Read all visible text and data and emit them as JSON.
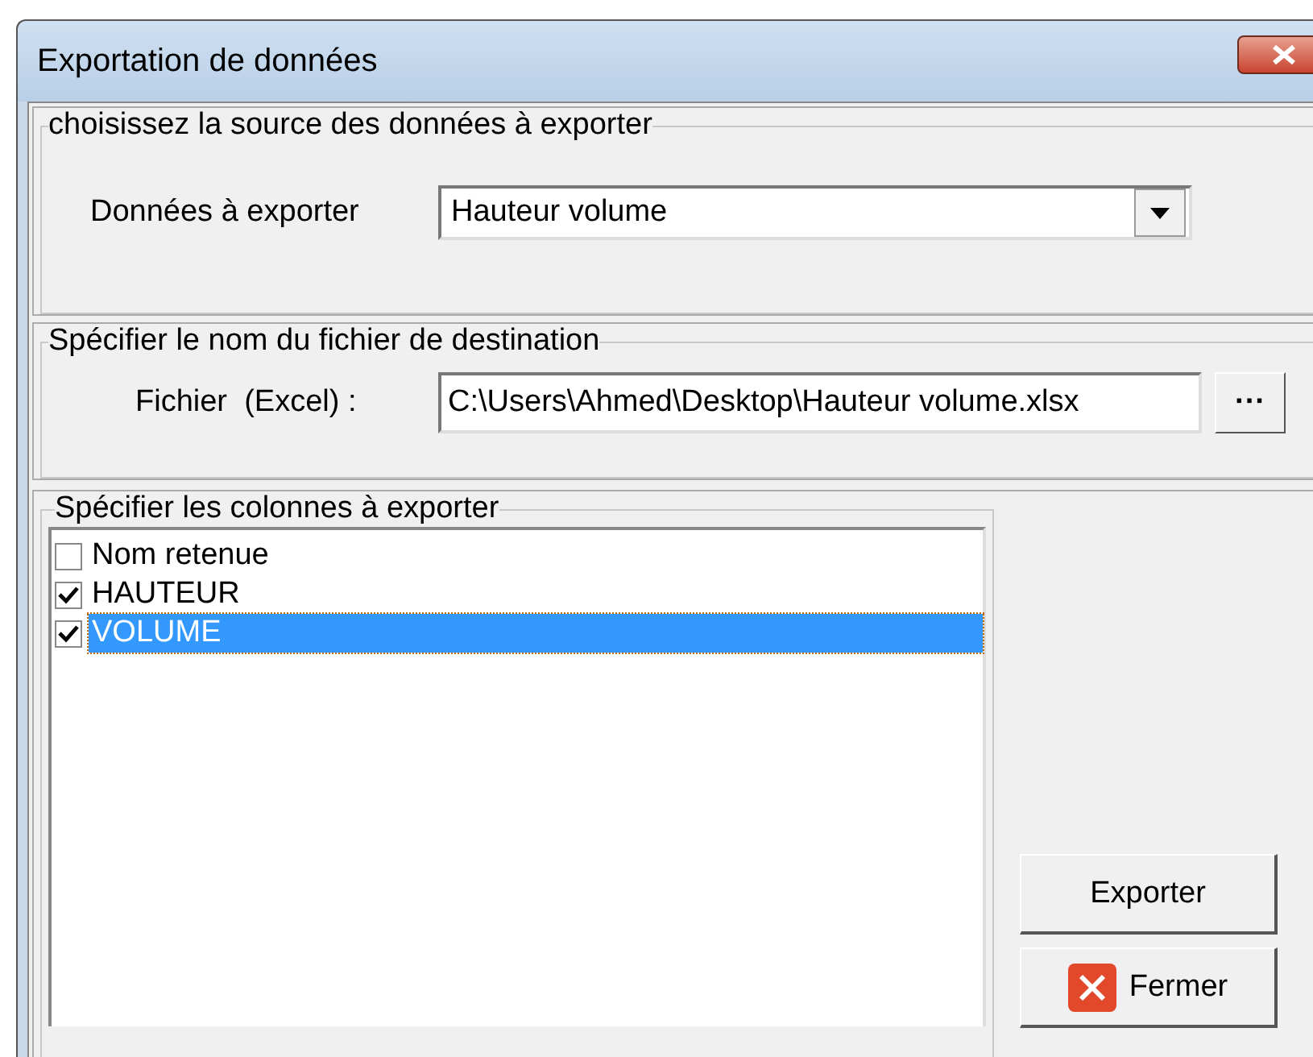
{
  "window": {
    "title": "Exportation de données"
  },
  "source_group": {
    "title": "choisissez la source des données à exporter",
    "label": "Données à exporter",
    "value": "Hauteur volume"
  },
  "file_group": {
    "title": "Spécifier le nom du fichier de destination",
    "label": "Fichier  (Excel) :",
    "value": "C:\\Users\\Ahmed\\Desktop\\Hauteur volume.xlsx",
    "browse": "···"
  },
  "columns_group": {
    "title": "Spécifier les colonnes à exporter",
    "items": [
      {
        "label": "Nom retenue",
        "checked": false,
        "selected": false
      },
      {
        "label": "HAUTEUR",
        "checked": true,
        "selected": false
      },
      {
        "label": "VOLUME",
        "checked": true,
        "selected": true
      }
    ]
  },
  "buttons": [
    {
      "kind": "export",
      "label": "Exporter"
    },
    {
      "kind": "close",
      "label": "Fermer"
    }
  ]
}
